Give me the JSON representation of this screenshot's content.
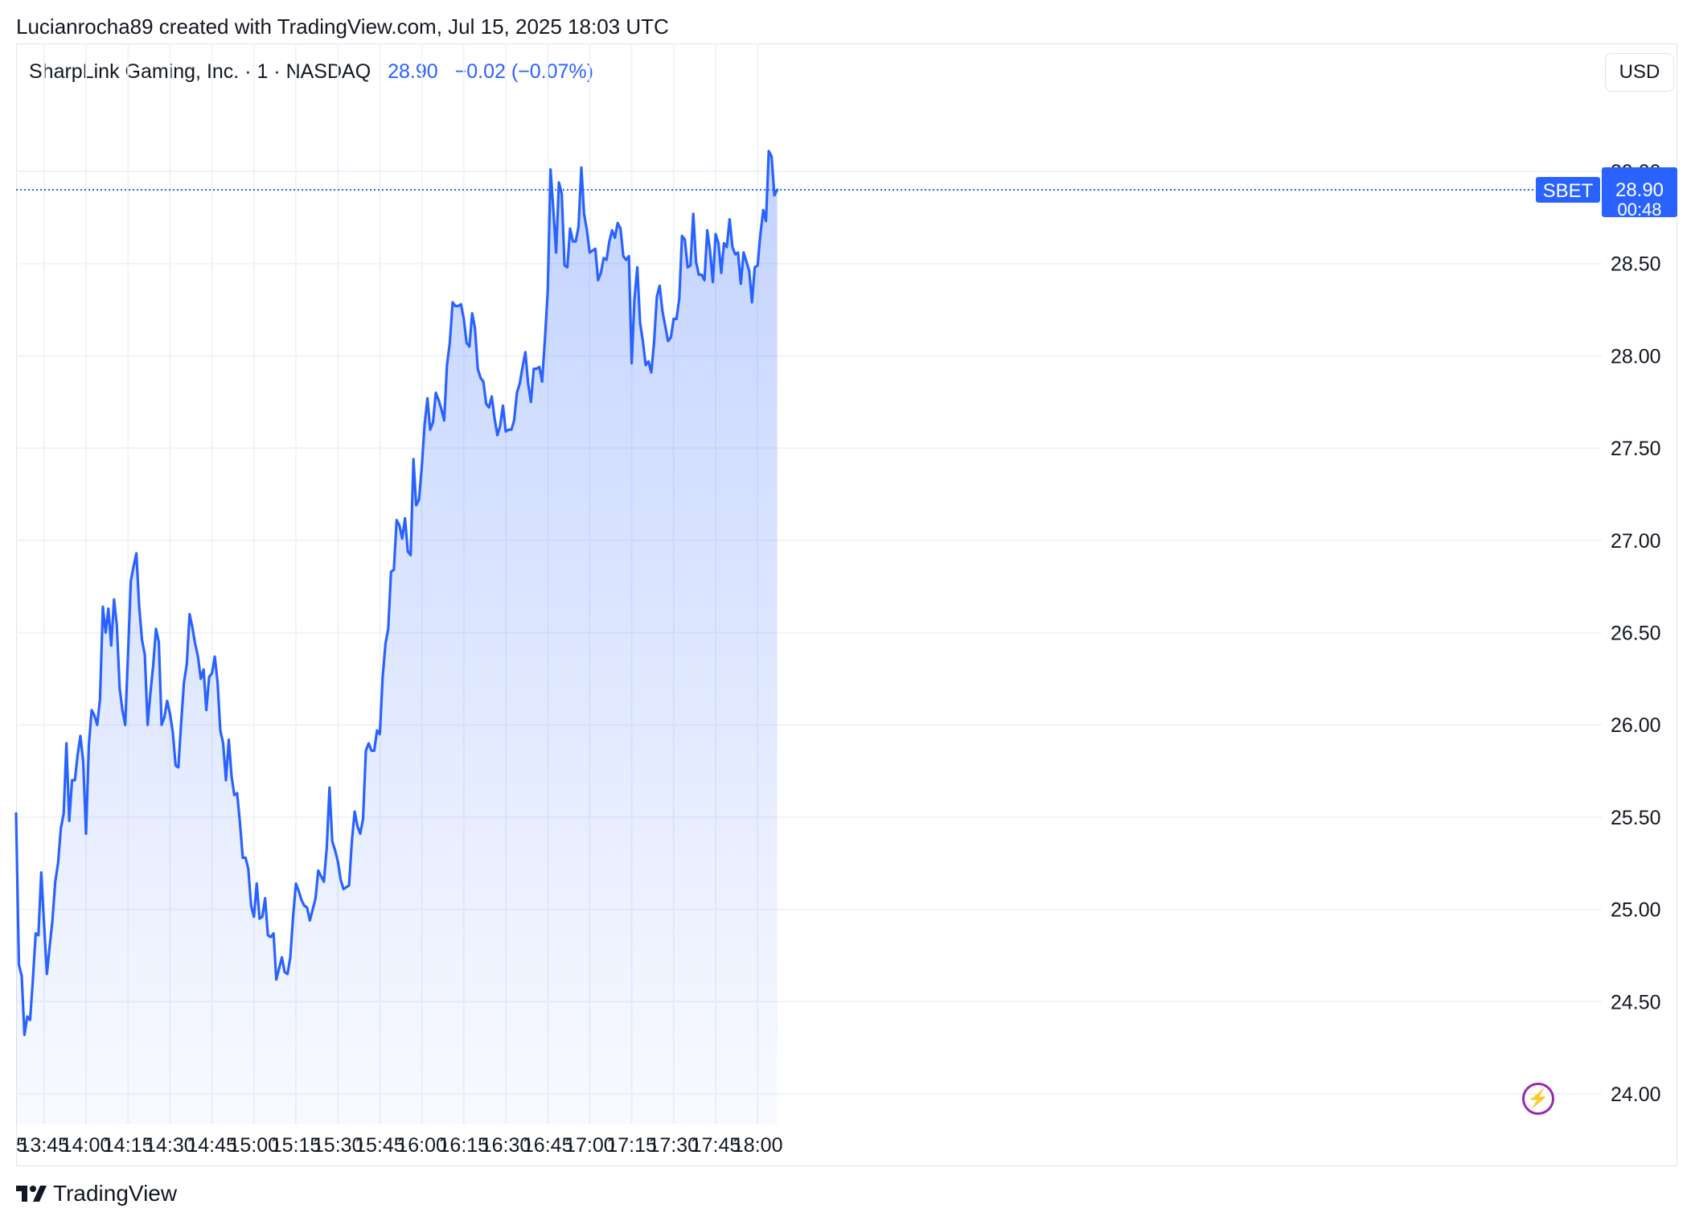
{
  "header": {
    "credit": "Lucianrocha89 created with TradingView.com, Jul 15, 2025 18:03 UTC"
  },
  "legend": {
    "symbol_text": "SharpLink Gaming, Inc. · 1 · NASDAQ",
    "last": "28.90",
    "change": "−0.02 (−0.07%)"
  },
  "currency_button": "USD",
  "price_tag": {
    "ticker": "SBET",
    "price": "28.90",
    "countdown": "00:48"
  },
  "brand": {
    "name": "TradingView"
  },
  "colors": {
    "line": "#2962ff",
    "grid": "#f0f3fa",
    "tag_bg": "#2962ff",
    "bolt": "#9c27b0"
  },
  "chart_data": {
    "type": "area",
    "title": "SharpLink Gaming, Inc. · 1 · NASDAQ",
    "ylim": [
      24.0,
      29.0
    ],
    "yticks": [
      "24.00",
      "24.50",
      "25.00",
      "25.50",
      "26.00",
      "26.50",
      "27.00",
      "27.50",
      "28.00",
      "28.50",
      "29.00"
    ],
    "xticks": [
      "5",
      "13:45",
      "14:00",
      "14:15",
      "14:30",
      "14:45",
      "15:00",
      "15:15",
      "15:30",
      "15:45",
      "16:00",
      "16:15",
      "16:30",
      "16:45",
      "17:00",
      "17:15",
      "17:30",
      "17:45",
      "18:00"
    ],
    "x_start": "13:35",
    "interval_minutes": 1,
    "series": [
      {
        "values": [
          25.52,
          24.7,
          24.64,
          24.32,
          24.42,
          24.4,
          24.62,
          24.87,
          24.86,
          25.2,
          24.92,
          24.65,
          24.8,
          24.94,
          25.15,
          25.25,
          25.44,
          25.52,
          25.9,
          25.48,
          25.7,
          25.7,
          25.84,
          25.94,
          25.8,
          25.41,
          25.89,
          26.08,
          26.05,
          26.0,
          26.14,
          26.64,
          26.5,
          26.63,
          26.43,
          26.68,
          26.54,
          26.2,
          26.08,
          26.0,
          26.38,
          26.78,
          26.86,
          26.93,
          26.64,
          26.46,
          26.38,
          26.0,
          26.17,
          26.32,
          26.52,
          26.45,
          26.0,
          26.04,
          26.13,
          26.06,
          25.96,
          25.78,
          25.77,
          26.01,
          26.23,
          26.33,
          26.6,
          26.53,
          26.44,
          26.37,
          26.25,
          26.3,
          26.08,
          26.26,
          26.28,
          26.37,
          26.23,
          25.97,
          25.9,
          25.7,
          25.92,
          25.72,
          25.62,
          25.63,
          25.47,
          25.28,
          25.28,
          25.22,
          25.02,
          24.96,
          25.14,
          24.95,
          24.96,
          25.06,
          24.86,
          24.85,
          24.87,
          24.62,
          24.68,
          24.74,
          24.66,
          24.65,
          24.74,
          24.96,
          25.14,
          25.1,
          25.05,
          25.02,
          25.01,
          24.94,
          25.0,
          25.06,
          25.21,
          25.18,
          25.15,
          25.33,
          25.66,
          25.37,
          25.32,
          25.26,
          25.16,
          25.11,
          25.12,
          25.13,
          25.37,
          25.53,
          25.45,
          25.41,
          25.49,
          25.86,
          25.9,
          25.86,
          25.86,
          25.97,
          25.95,
          26.26,
          26.44,
          26.52,
          26.83,
          26.84,
          27.11,
          27.08,
          27.01,
          27.12,
          26.94,
          26.92,
          27.44,
          27.19,
          27.22,
          27.4,
          27.63,
          27.77,
          27.6,
          27.64,
          27.8,
          27.76,
          27.71,
          27.65,
          27.95,
          28.07,
          28.29,
          28.27,
          28.27,
          28.28,
          28.2,
          28.07,
          28.05,
          28.23,
          28.15,
          27.93,
          27.88,
          27.86,
          27.74,
          27.72,
          27.78,
          27.66,
          27.57,
          27.62,
          27.73,
          27.59,
          27.6,
          27.6,
          27.65,
          27.8,
          27.85,
          27.94,
          28.02,
          27.85,
          27.75,
          27.93,
          27.93,
          27.94,
          27.86,
          28.09,
          28.35,
          29.01,
          28.79,
          28.56,
          28.94,
          28.88,
          28.49,
          28.48,
          28.69,
          28.62,
          28.62,
          28.7,
          29.02,
          28.77,
          28.68,
          28.56,
          28.57,
          28.58,
          28.41,
          28.45,
          28.53,
          28.52,
          28.62,
          28.68,
          28.64,
          28.72,
          28.69,
          28.54,
          28.52,
          28.54,
          27.96,
          28.31,
          28.48,
          28.18,
          28.08,
          27.95,
          27.97,
          27.91,
          28.07,
          28.32,
          28.38,
          28.24,
          28.16,
          28.08,
          28.1,
          28.2,
          28.2,
          28.31,
          28.65,
          28.63,
          28.48,
          28.49,
          28.77,
          28.51,
          28.44,
          28.44,
          28.41,
          28.68,
          28.57,
          28.4,
          28.66,
          28.61,
          28.45,
          28.61,
          28.59,
          28.74,
          28.59,
          28.55,
          28.56,
          28.39,
          28.56,
          28.51,
          28.46,
          28.29,
          28.48,
          28.49,
          28.66,
          28.79,
          28.73,
          29.11,
          29.08,
          28.87,
          28.9
        ]
      }
    ]
  }
}
